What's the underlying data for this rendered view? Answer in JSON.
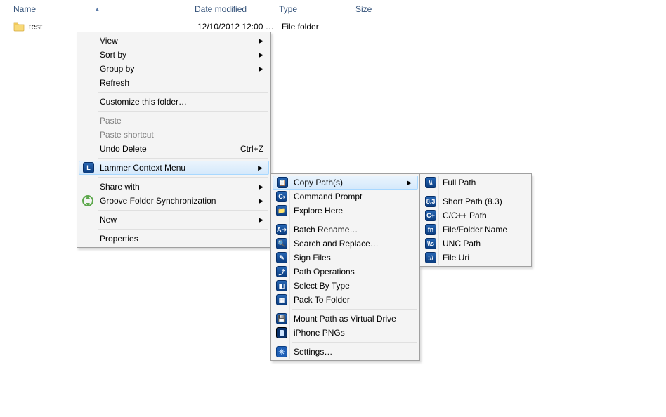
{
  "columns": {
    "name": "Name",
    "date": "Date modified",
    "type": "Type",
    "size": "Size",
    "sort_arrow": "▲"
  },
  "file": {
    "name": "test",
    "date": "12/10/2012 12:00 …",
    "type": "File folder"
  },
  "menu_main": [
    {
      "kind": "item",
      "label": "View",
      "arrow": true
    },
    {
      "kind": "item",
      "label": "Sort by",
      "arrow": true
    },
    {
      "kind": "item",
      "label": "Group by",
      "arrow": true
    },
    {
      "kind": "item",
      "label": "Refresh"
    },
    {
      "kind": "sep"
    },
    {
      "kind": "item",
      "label": "Customize this folder…"
    },
    {
      "kind": "sep"
    },
    {
      "kind": "item",
      "label": "Paste",
      "disabled": true
    },
    {
      "kind": "item",
      "label": "Paste shortcut",
      "disabled": true
    },
    {
      "kind": "item",
      "label": "Undo Delete",
      "accel": "Ctrl+Z"
    },
    {
      "kind": "sep"
    },
    {
      "kind": "item",
      "label": "Lammer Context Menu",
      "arrow": true,
      "highlight": true,
      "icon": "lammer",
      "icon_text": "L"
    },
    {
      "kind": "sep"
    },
    {
      "kind": "item",
      "label": "Share with",
      "arrow": true
    },
    {
      "kind": "item",
      "label": "Groove Folder Synchronization",
      "arrow": true,
      "icon": "sync"
    },
    {
      "kind": "sep"
    },
    {
      "kind": "item",
      "label": "New",
      "arrow": true
    },
    {
      "kind": "sep"
    },
    {
      "kind": "item",
      "label": "Properties"
    }
  ],
  "menu_lammer": [
    {
      "kind": "item",
      "label": "Copy Path(s)",
      "arrow": true,
      "highlight": true,
      "icon": "blue",
      "icon_text": "📋"
    },
    {
      "kind": "item",
      "label": "Command Prompt",
      "icon": "blue",
      "icon_text": "C›"
    },
    {
      "kind": "item",
      "label": "Explore Here",
      "icon": "blue",
      "icon_text": "📁"
    },
    {
      "kind": "sep"
    },
    {
      "kind": "item",
      "label": "Batch Rename…",
      "icon": "blue",
      "icon_text": "A➜"
    },
    {
      "kind": "item",
      "label": "Search and Replace…",
      "icon": "blue",
      "icon_text": "🔍"
    },
    {
      "kind": "item",
      "label": "Sign Files",
      "icon": "blue",
      "icon_text": "✎"
    },
    {
      "kind": "item",
      "label": "Path Operations",
      "icon": "blue",
      "icon_text": "⤴"
    },
    {
      "kind": "item",
      "label": "Select By Type",
      "icon": "blue",
      "icon_text": "◧"
    },
    {
      "kind": "item",
      "label": "Pack To Folder",
      "icon": "blue",
      "icon_text": "▦"
    },
    {
      "kind": "sep"
    },
    {
      "kind": "item",
      "label": "Mount Path as Virtual Drive",
      "icon": "blue",
      "icon_text": "💾"
    },
    {
      "kind": "item",
      "label": "iPhone PNGs",
      "icon": "iphone"
    },
    {
      "kind": "sep"
    },
    {
      "kind": "item",
      "label": "Settings…",
      "icon": "settings"
    }
  ],
  "menu_copypath": [
    {
      "kind": "item",
      "label": "Full Path",
      "icon": "blue",
      "icon_text": "\\\\"
    },
    {
      "kind": "sep"
    },
    {
      "kind": "item",
      "label": "Short Path (8.3)",
      "icon": "blue",
      "icon_text": "8.3"
    },
    {
      "kind": "item",
      "label": "C/C++ Path",
      "icon": "blue",
      "icon_text": "C+"
    },
    {
      "kind": "item",
      "label": "File/Folder Name",
      "icon": "blue",
      "icon_text": "fn"
    },
    {
      "kind": "item",
      "label": "UNC Path",
      "icon": "blue",
      "icon_text": "\\\\s"
    },
    {
      "kind": "item",
      "label": "File Uri",
      "icon": "blue",
      "icon_text": "://"
    }
  ],
  "submenu_arrow_glyph": "▶"
}
